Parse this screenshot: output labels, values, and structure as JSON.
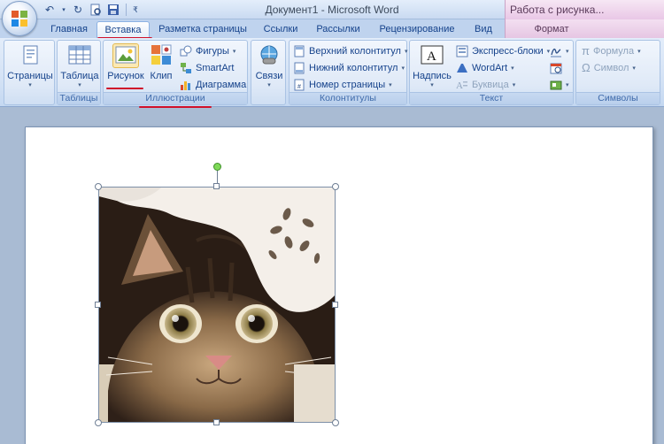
{
  "window": {
    "title": "Документ1 - Microsoft Word",
    "context_tab_group": "Работа с рисунка..."
  },
  "quick_access": {
    "icons": [
      "undo-icon",
      "redo-icon",
      "print-preview-icon",
      "save-icon",
      "customize-qat-icon"
    ]
  },
  "tabs": [
    {
      "label": "Главная"
    },
    {
      "label": "Вставка"
    },
    {
      "label": "Разметка страницы"
    },
    {
      "label": "Ссылки"
    },
    {
      "label": "Рассылки"
    },
    {
      "label": "Рецензирование"
    },
    {
      "label": "Вид"
    },
    {
      "label": "Формат"
    }
  ],
  "active_tab": "Вставка",
  "ribbon": {
    "pages": {
      "label": "Страницы"
    },
    "tables": {
      "button": "Таблица",
      "group": "Таблицы"
    },
    "illustrations": {
      "group": "Иллюстрации",
      "picture": "Рисунок",
      "clip": "Клип",
      "shapes": "Фигуры",
      "smartart": "SmartArt",
      "chart": "Диаграмма"
    },
    "links": {
      "button": "Связи"
    },
    "header_footer": {
      "group": "Колонтитулы",
      "header": "Верхний колонтитул",
      "footer": "Нижний колонтитул",
      "page_number": "Номер страницы"
    },
    "text": {
      "group": "Текст",
      "textbox": "Надпись",
      "quick_parts": "Экспресс-блоки",
      "wordart": "WordArt",
      "drop_cap": "Буквица"
    },
    "symbols": {
      "group": "Символы",
      "equation": "Формула",
      "symbol": "Символ"
    }
  },
  "colors": {
    "highlight_underline": "#d0102a",
    "context_tab": "#e9c7e6",
    "ribbon_text": "#15428b"
  }
}
